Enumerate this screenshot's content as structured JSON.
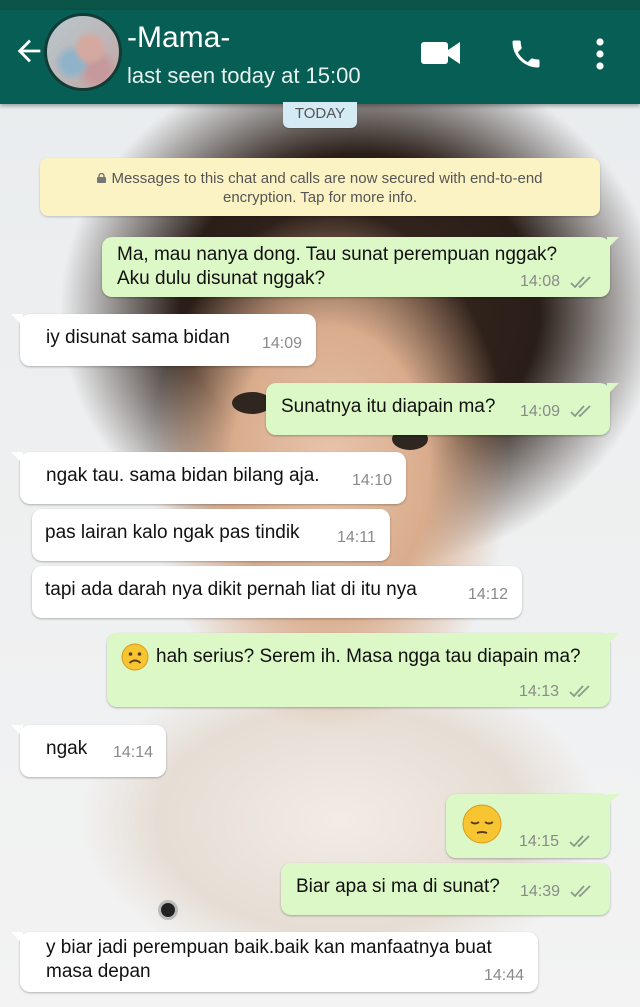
{
  "header": {
    "contact_name": "-Mama-",
    "status": "last seen today at 15:00",
    "back_icon": "arrow-left-icon",
    "video_icon": "video-camera-icon",
    "call_icon": "phone-icon",
    "menu_icon": "more-vert-icon"
  },
  "date_label": "TODAY",
  "encryption_notice": {
    "line1": "Messages to this chat and calls are now secured with end-to-end",
    "line2": "encryption. Tap for more info."
  },
  "messages": [
    {
      "dir": "out",
      "lines": [
        "Ma, mau nanya dong. Tau sunat perempuan nggak?",
        "Aku dulu disunat nggak?"
      ],
      "time": "14:08"
    },
    {
      "dir": "in",
      "lines": [
        "iy disunat sama bidan"
      ],
      "time": "14:09"
    },
    {
      "dir": "out",
      "lines": [
        "Sunatnya itu diapain ma?"
      ],
      "time": "14:09"
    },
    {
      "dir": "in",
      "lines": [
        "ngak tau. sama bidan bilang aja."
      ],
      "time": "14:10"
    },
    {
      "dir": "in",
      "lines": [
        "pas lairan kalo ngak pas tindik"
      ],
      "time": "14:11"
    },
    {
      "dir": "in",
      "lines": [
        "tapi ada darah nya dikit pernah liat di itu nya"
      ],
      "time": "14:12"
    },
    {
      "dir": "out",
      "emoji": "frowning-face",
      "lines": [
        "hah serius? Serem ih. Masa ngga tau diapain ma?"
      ],
      "time": "14:13"
    },
    {
      "dir": "in",
      "lines": [
        "ngak"
      ],
      "time": "14:14"
    },
    {
      "dir": "out",
      "emoji": "pensive-face",
      "lines": [],
      "time": "14:15"
    },
    {
      "dir": "out",
      "lines": [
        "Biar apa si ma di sunat?"
      ],
      "time": "14:39"
    },
    {
      "dir": "in",
      "lines": [
        "y biar jadi perempuan baik.baik kan manfaatnya buat",
        "masa depan"
      ],
      "time": "14:44"
    }
  ],
  "colors": {
    "header": "#075e54",
    "incoming_bubble": "#ffffff",
    "outgoing_bubble": "#dcf8c6",
    "encryption_bg": "#fcf3c5",
    "date_chip_bg": "#d4eaf4"
  }
}
